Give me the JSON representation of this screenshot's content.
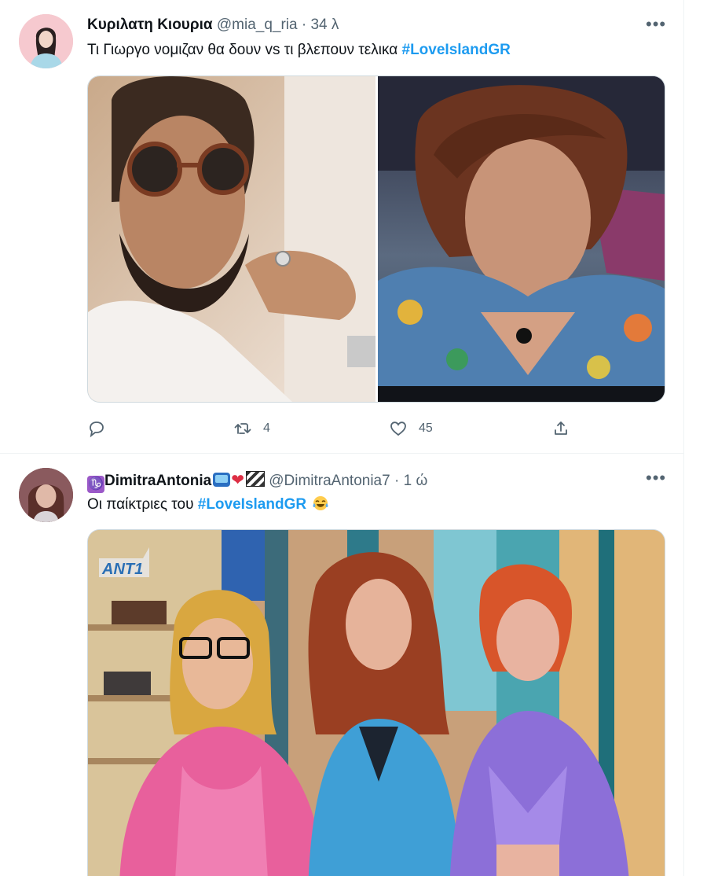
{
  "colors": {
    "accent": "#1d9bf0",
    "secondary_text": "#536471",
    "like": "#536471"
  },
  "tweets": [
    {
      "name": "Κυριλατη Κιουρια",
      "handle": "@mia_q_ria",
      "separator": "·",
      "time": "34 λ",
      "more_icon": "more-icon",
      "text": "Τι Γιωργο νομιζαν θα δουν vs τι βλεπουν τελικα",
      "hashtag": "#LoveIslandGR",
      "media": [
        "left-photo-man-sunglasses",
        "right-photo-man-floral-shirt"
      ],
      "actions": {
        "reply": "",
        "retweet": "4",
        "like": "45",
        "share": ""
      }
    },
    {
      "name_prefix_icon": "capricorn-icon",
      "name": "DimitraAntonia",
      "name_suffix_icons": [
        "tv-icon",
        "heart-icon",
        "clapper-icon"
      ],
      "handle": "@DimitraAntonia7",
      "separator": "·",
      "time": "1 ώ",
      "more_icon": "more-icon",
      "text": "Οι παίκτριες του",
      "hashtag": "#LoveIslandGR",
      "emoji": "joy-emoji",
      "media": [
        "three-women-tv-show"
      ],
      "media_logo": "ANT1"
    }
  ]
}
